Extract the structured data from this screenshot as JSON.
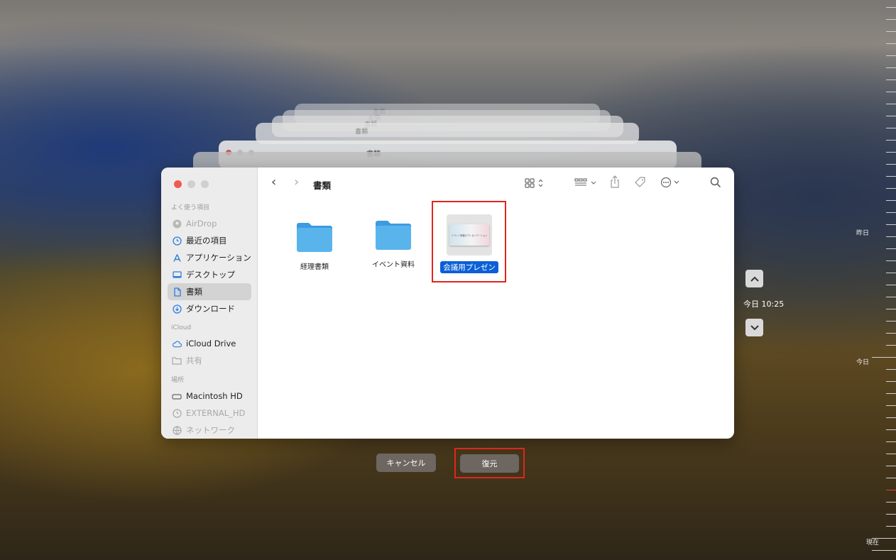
{
  "window": {
    "path_title": "書類",
    "background_titles": [
      "書類",
      "書類",
      "書類",
      "書類",
      "書類"
    ]
  },
  "sidebar": {
    "favorites_header": "よく使う項目",
    "items": [
      {
        "label": "AirDrop",
        "icon": "airdrop-icon"
      },
      {
        "label": "最近の項目",
        "icon": "clock-icon"
      },
      {
        "label": "アプリケーション",
        "icon": "applications-icon"
      },
      {
        "label": "デスクトップ",
        "icon": "desktop-icon"
      },
      {
        "label": "書類",
        "icon": "document-icon",
        "selected": true
      },
      {
        "label": "ダウンロード",
        "icon": "download-icon"
      }
    ],
    "icloud_header": "iCloud",
    "icloud_items": [
      {
        "label": "iCloud Drive",
        "icon": "cloud-icon"
      },
      {
        "label": "共有",
        "icon": "shared-folder-icon"
      }
    ],
    "locations_header": "場所",
    "location_items": [
      {
        "label": "Macintosh HD",
        "icon": "disk-icon"
      },
      {
        "label": "EXTERNAL_HD",
        "icon": "time-machine-icon"
      },
      {
        "label": "ネットワーク",
        "icon": "network-icon"
      }
    ]
  },
  "files": [
    {
      "name": "経理書類",
      "type": "folder"
    },
    {
      "name": "イベント資料",
      "type": "folder"
    },
    {
      "name": "会議用プレゼン",
      "type": "presentation",
      "selected": true,
      "thumbnail_text": "イベント開催のプレゼンテーション"
    }
  ],
  "buttons": {
    "cancel": "キャンセル",
    "restore": "復元"
  },
  "timeline": {
    "current_snapshot": "今日 10:25",
    "labels": {
      "yesterday": "昨日",
      "today": "今日",
      "now": "現在"
    }
  },
  "colors": {
    "selection": "#0a5fd8",
    "highlight_box": "#e0261c",
    "folder": "#5ab4ec",
    "button": "#6e6660"
  }
}
